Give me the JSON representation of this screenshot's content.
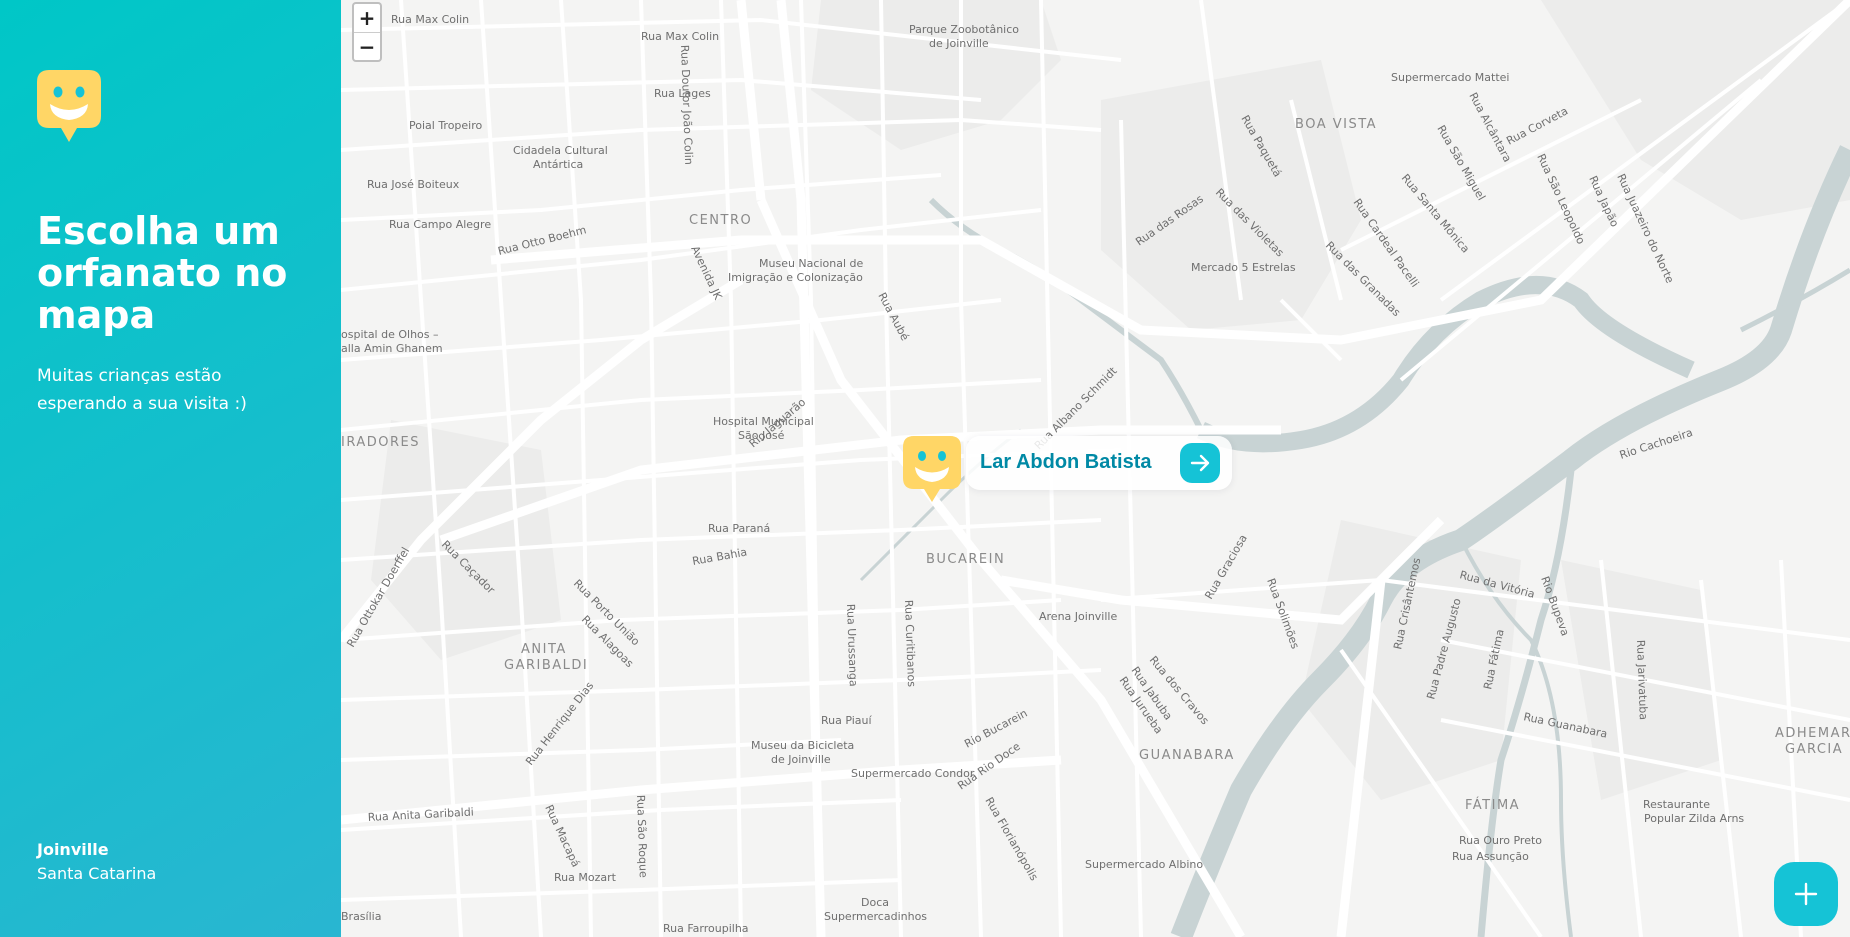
{
  "sidebar": {
    "title": "Escolha um orfanato no mapa",
    "subtitle": "Muitas crianças estão esperando a sua visita :)",
    "city": "Joinville",
    "state": "Santa Catarina"
  },
  "map": {
    "zoom_in_label": "+",
    "zoom_out_label": "−",
    "labels": {
      "rua_max_colin_1": "Rua Max Colin",
      "rua_max_colin_2": "Rua Max Colin",
      "parque": "Parque Zoobotânico",
      "parque2": "de Joinville",
      "supermercado_mattei": "Supermercado Mattei",
      "boa_vista": "BOA VISTA",
      "rua_lages": "Rua Lages",
      "poial": "Poial Tropeiro",
      "cidadela1": "Cidadela Cultural",
      "cidadela2": "Antártica",
      "rua_jose_boiteux": "Rua José Boiteux",
      "rua_campo_alegre": "Rua Campo Alegre",
      "rua_otto_boehm": "Rua Otto Boehm",
      "centro": "CENTRO",
      "museu_nacional1": "Museu Nacional de",
      "museu_nacional2": "Imigração e Colonização",
      "mercado": "Mercado 5 Estrelas",
      "hospital_olhos1": "ospital de Olhos –",
      "hospital_olhos2": "alla Amin Ghanem",
      "hospital_municipal1": "Hospital Municipal",
      "hospital_municipal2": "São José",
      "iradores": "IRADORES",
      "rua_parana": "Rua Paraná",
      "rua_bahia": "Rua Bahia",
      "bucarein": "BUCAREIN",
      "arena": "Arena Joinville",
      "anita1": "ANITA",
      "anita2": "GARIBALDI",
      "rua_piaui": "Rua Piauí",
      "museu_bicicleta1": "Museu da Bicicleta",
      "museu_bicicleta2": "de Joinville",
      "supermercado_condor": "Supermercado Condor",
      "guanabara": "GUANABARA",
      "fatima": "FÁTIMA",
      "rua_guanabara": "Rua Guanabara",
      "restaurante1": "Restaurante",
      "restaurante2": "Popular Zilda Arns",
      "adhemar1": "ADHEMAR",
      "adhemar2": "GARCIA",
      "rua_anita": "Rua Anita Garibaldi",
      "rua_mozart": "Rua Mozart",
      "brasilia": "Brasília",
      "rua_farroupilha": "Rua Farroupilha",
      "doca1": "Doca",
      "doca2": "Supermercadinhos",
      "supermercado_albino": "Supermercado Albino",
      "rua_ouro_preto": "Rua Ouro Preto",
      "rua_assuncao": "Rua Assunção",
      "rio_cachoeira": "Rio Cachoeira",
      "rua_doutor_joao_colin": "Rua Doutor João Colin",
      "avenida_jk": "Avenida JK",
      "rua_aube": "Rua Aubé",
      "rua_albano": "Rua Albano Schmidt",
      "rio_jaguarao": "Rio Jaguarão",
      "rua_uruguai": "Rua Urussanga",
      "rua_curitibanos": "Rua Curitibanos",
      "rua_ottokar": "Rua Ottokar Doerffel",
      "rua_cacador": "Rua Caçador",
      "rua_porto_uniao": "Rua Porto União",
      "rua_alagoas": "Rua Alagoas",
      "rua_henrique_dias": "Rua Henrique Dias",
      "rua_sao_roque": "Rua São Roque",
      "rua_macapa": "Rua Macapá",
      "rio_bucarein": "Rio Bucarein",
      "rua_rio_doce": "Rua Rio Doce",
      "rua_florianopolis": "Rua Florianópolis",
      "rua_dos_cravos": "Rua dos Cravos",
      "rua_jaraba": "Rua Jabuba",
      "rua_jurueba": "Rua Jurueba",
      "rua_graciosa": "Rua Graciosa",
      "rua_solimoes": "Rua Solimões",
      "rua_crisantemos": "Rua Crisântemos",
      "rua_da_vitoria": "Rua da Vitória",
      "rio_bupeva": "Rio Bupeva",
      "rua_padre_augusto": "Rua Padre Augusto",
      "rua_fatima": "Rua Fátima",
      "rua_jarivatuba": "Rua Jarivatuba",
      "rua_das_rosas": "Rua das Rosas",
      "rua_das_violetas": "Rua das Violetas",
      "rua_paqueta": "Rua Paquetá",
      "rua_das_granadas": "Rua das Granadas",
      "rua_cardeal": "Rua Cardeal Pacelli",
      "rua_santa_monica": "Rua Santa Mônica",
      "rua_sao_miguel": "Rua São Miguel",
      "rua_alcantara": "Rua Alcântara",
      "rua_corveta": "Rua Corveta",
      "rua_sao_leopoldo": "Rua São Leopoldo",
      "rua_japao": "Rua Japão",
      "rua_juazeiro": "Rua Juazeiro do Norte"
    },
    "colors": {
      "water": "#c8d3d4",
      "road": "#ffffff",
      "land": "#f4f4f3"
    }
  },
  "marker": {
    "name": "Lar Abdon Batista",
    "icon": "happy-face-pin-icon",
    "action_icon": "arrow-right-icon"
  },
  "fab": {
    "icon": "plus-icon"
  },
  "colors": {
    "sidebar_gradient_start": "#00c7c7",
    "sidebar_gradient_end": "#29b6d1",
    "pin_yellow": "#ffd666",
    "accent": "#15c3d6",
    "popup_text": "#0089a5"
  }
}
